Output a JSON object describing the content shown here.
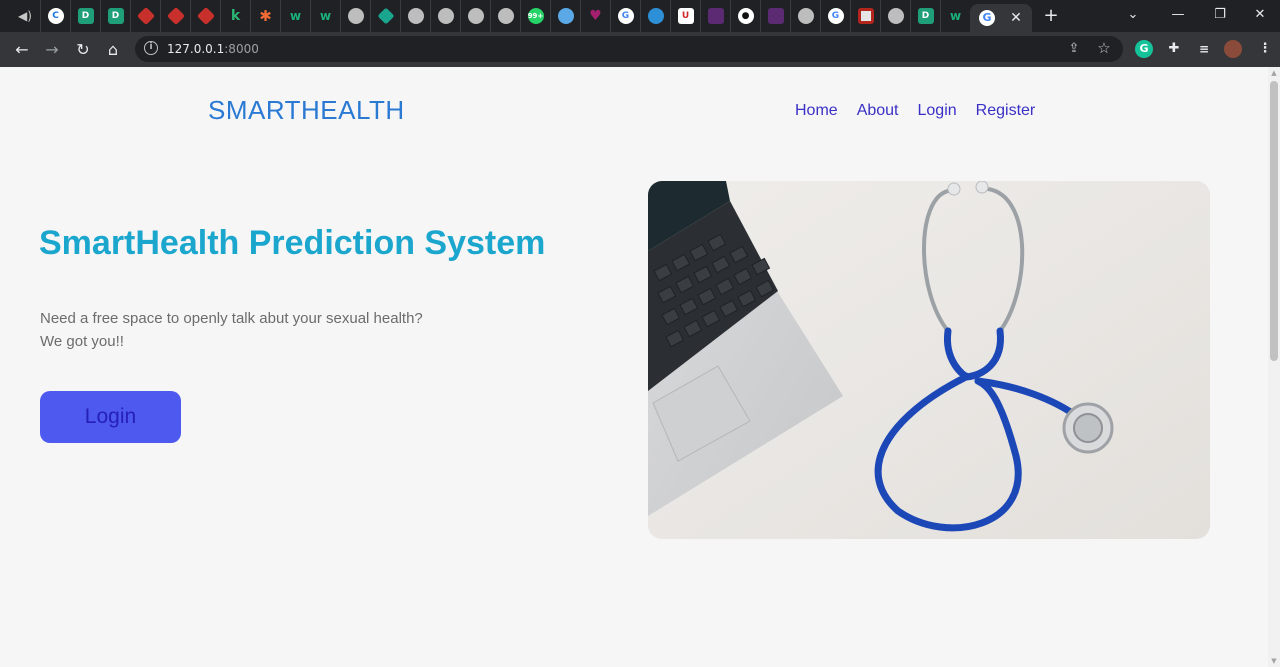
{
  "browser": {
    "active_tab_title": "",
    "url_host": "127.0.0.1",
    "url_port": ":8000"
  },
  "site": {
    "brand": "SMARTHEALTH",
    "nav": [
      "Home",
      "About",
      "Login",
      "Register"
    ]
  },
  "hero": {
    "title": "SmartHealth Prediction System",
    "subtitle_line1": "Need a free space to openly talk abut your sexual health?",
    "subtitle_line2": "We got you!!",
    "login_label": "Login"
  },
  "colors": {
    "brand": "#2a7ad4",
    "nav_link": "#3a30c6",
    "title": "#1ba6ce",
    "button_bg": "#4d59ef",
    "button_text": "#2620b8",
    "page_bg": "#f6f6f6"
  },
  "icons": {
    "image_subject": "laptop-and-stethoscope-photo"
  }
}
